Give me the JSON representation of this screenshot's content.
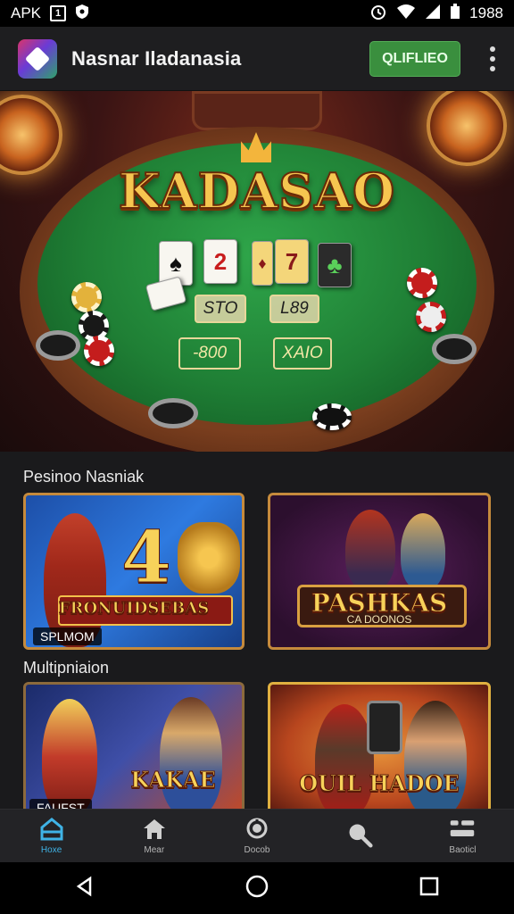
{
  "status_bar": {
    "left_text": "APK",
    "box_glyph": "1",
    "time": "1988"
  },
  "app_bar": {
    "title": "Nasnar Iladanasia",
    "cta_label": "QLIFLIEO"
  },
  "hero": {
    "title": "KADASAO",
    "cards": [
      "♠",
      "2",
      "♦",
      "7",
      "♣"
    ],
    "bets": [
      "STO",
      "L89",
      "-800",
      "XAIO"
    ]
  },
  "sections": [
    {
      "label": "Pesinoo Nasniak",
      "tiles": [
        {
          "title": "FRONUIDSEBAS",
          "big_text": "4",
          "badge": "SPLMOM"
        },
        {
          "title": "PASHKAS",
          "subtitle": "CA DOONOS"
        }
      ]
    },
    {
      "label": "Multipniaion",
      "tiles": [
        {
          "title": "KAKAE",
          "badge": "FAUFST"
        },
        {
          "title": "OUIL HADOE"
        }
      ]
    }
  ],
  "bottom_nav": [
    {
      "label": "Hoxe",
      "icon": "home-outline-icon",
      "active": true
    },
    {
      "label": "Mear",
      "icon": "home-icon"
    },
    {
      "label": "Docob",
      "icon": "search-pin-icon"
    },
    {
      "label": "",
      "icon": "search-icon"
    },
    {
      "label": "Baoticl",
      "icon": "menu-icon"
    }
  ],
  "colors": {
    "accent": "#3fb3e6",
    "cta": "#3a8f3e",
    "felt": "#1f7f35",
    "gold": "#f6c650"
  }
}
